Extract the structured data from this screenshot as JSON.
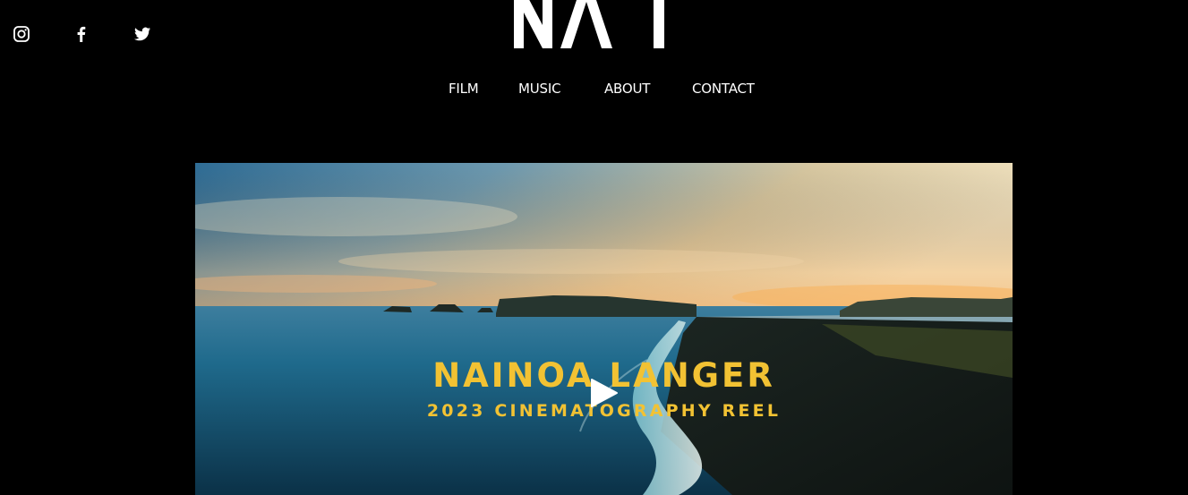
{
  "social": {
    "items": [
      {
        "name": "instagram",
        "icon": "instagram-icon"
      },
      {
        "name": "facebook",
        "icon": "facebook-icon"
      },
      {
        "name": "twitter",
        "icon": "twitter-icon"
      }
    ]
  },
  "logo": {
    "text": "NAL"
  },
  "nav": {
    "items": [
      {
        "label": "FILM"
      },
      {
        "label": "MUSIC"
      },
      {
        "label": "ABOUT"
      },
      {
        "label": "CONTACT"
      }
    ]
  },
  "video": {
    "title": "NAINOA LANGER",
    "subtitle": "2023 CINEMATOGRAPHY REEL",
    "play_icon": "play-icon",
    "text_color": "#f2c233"
  },
  "colors": {
    "background": "#000000",
    "text": "#ffffff",
    "accent": "#f2c233"
  }
}
